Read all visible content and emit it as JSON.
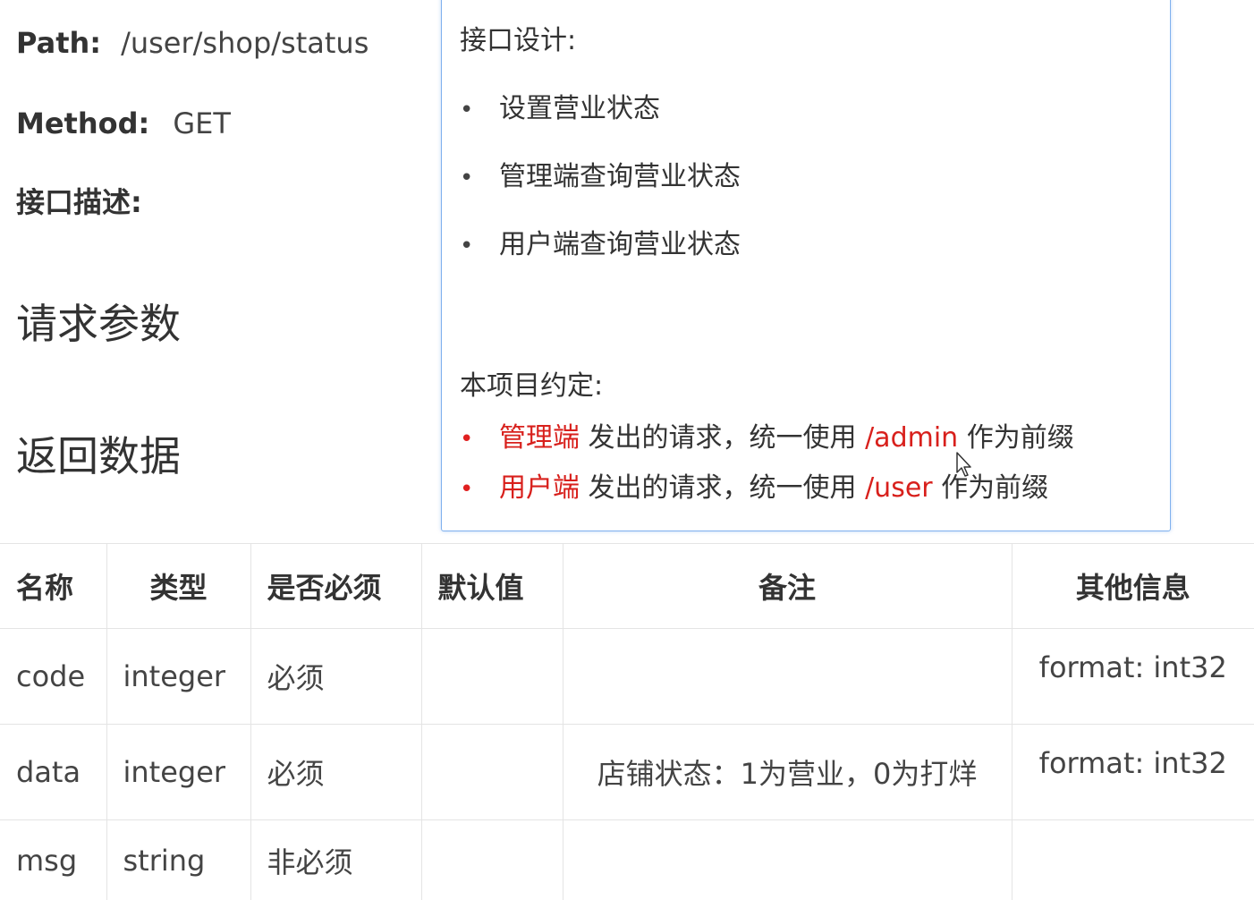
{
  "doc": {
    "path_label": "Path:",
    "path_value": "/user/shop/status",
    "method_label": "Method:",
    "method_value": "GET",
    "desc_label": "接口描述:",
    "request_params_title": "请求参数",
    "response_title": "返回数据"
  },
  "popup": {
    "design_heading": "接口设计:",
    "design_items": [
      "设置营业状态",
      "管理端查询营业状态",
      "用户端查询营业状态"
    ],
    "convention_heading": "本项目约定:",
    "conventions": [
      {
        "actor": "管理端",
        "middle": " 发出的请求，统一使用 ",
        "prefix": "/admin",
        "tail": " 作为前缀"
      },
      {
        "actor": "用户端",
        "middle": " 发出的请求，统一使用 ",
        "prefix": "/user",
        "tail": " 作为前缀"
      }
    ],
    "bullet_glyph": "•"
  },
  "table": {
    "headers": [
      "名称",
      "类型",
      "是否必须",
      "默认值",
      "备注",
      "其他信息"
    ],
    "rows": [
      {
        "name": "code",
        "type": "integer",
        "required": "必须",
        "default": "",
        "note": "",
        "other": "format: int32"
      },
      {
        "name": "data",
        "type": "integer",
        "required": "必须",
        "default": "",
        "note": "店铺状态：1为营业，0为打烊",
        "other": "format: int32"
      },
      {
        "name": "msg",
        "type": "string",
        "required": "非必须",
        "default": "",
        "note": "",
        "other": ""
      }
    ]
  },
  "colors": {
    "accent_red": "#d8201c",
    "card_border": "#7fb1ee",
    "grid_line": "#e4e4e4"
  },
  "icons": {
    "cursor": "arrow-pointer-icon"
  }
}
